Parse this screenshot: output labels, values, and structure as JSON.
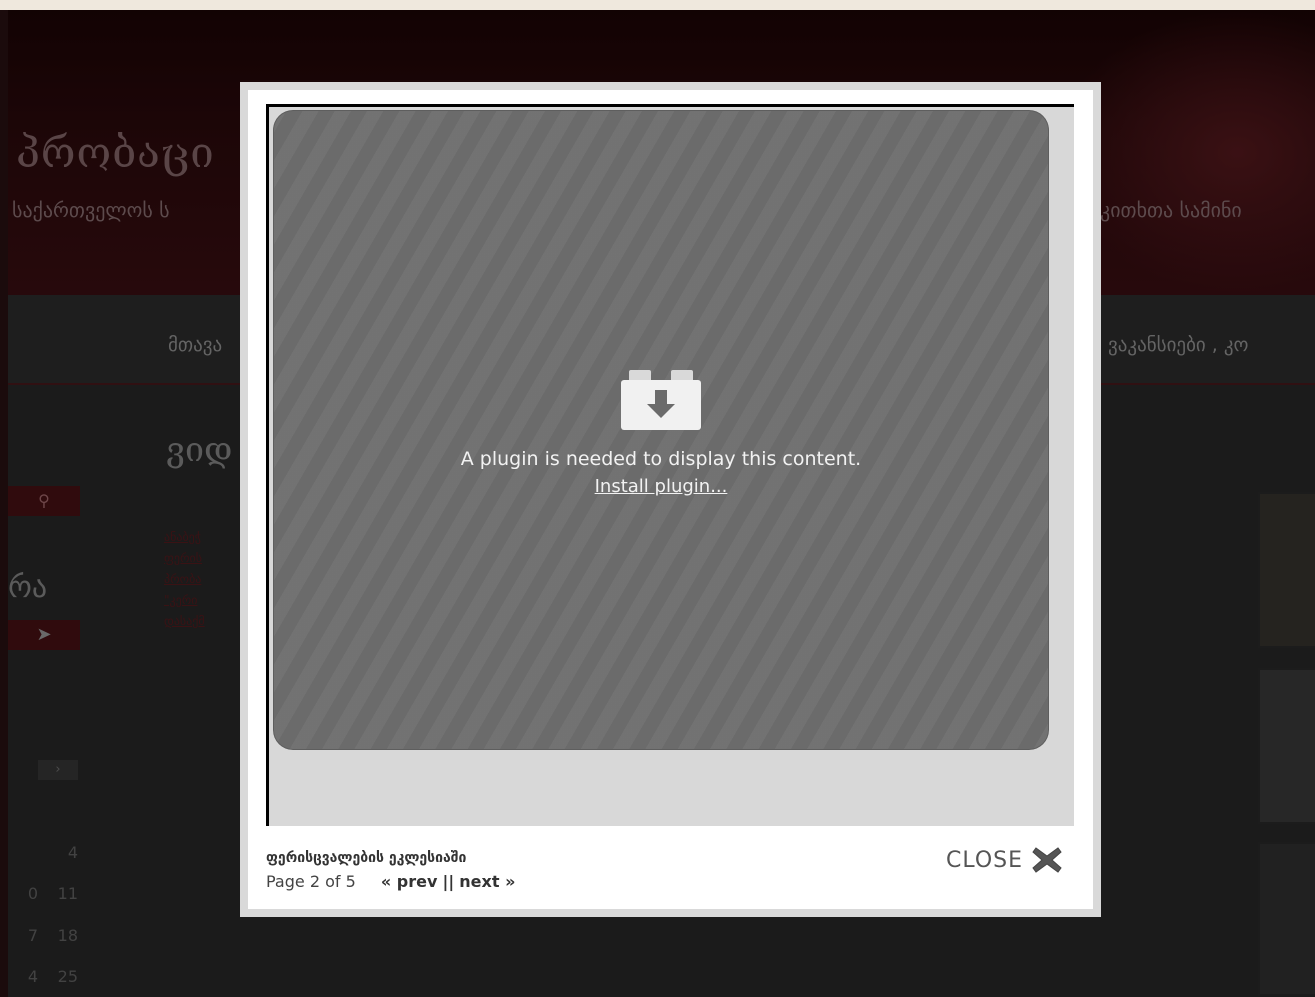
{
  "background_site": {
    "title": "პრობაცი",
    "subtitle_left": "საქართველოს ს",
    "subtitle_right": "კითხთა სამინი",
    "nav_left": "მთავა",
    "nav_right": "ვაკანსიები , კო",
    "content_heading": "ვიდ",
    "side_word": "რა",
    "links": [
      "ანაბეჭ",
      "ფერის",
      "პრობა",
      "\"კერი",
      "დასაქმ"
    ],
    "calendar_rows": [
      [
        "",
        "4"
      ],
      [
        "0",
        "11"
      ],
      [
        "7",
        "18"
      ],
      [
        "4",
        "25"
      ]
    ],
    "colors": {
      "header": "#2c0a0c",
      "accent": "#4a1215"
    }
  },
  "lightbox": {
    "plugin_message": "A plugin is needed to display this content.",
    "install_link": "Install plugin...",
    "caption_title": "ფერისცვალების ეკლესიაში",
    "page_indicator": "Page 2 of 5",
    "prev_label": "« prev",
    "separator": "||",
    "next_label": "next »",
    "close_label": "CLOSE",
    "close_icon": "close-x-icon",
    "plugin_icon": "plugin-download-icon"
  }
}
